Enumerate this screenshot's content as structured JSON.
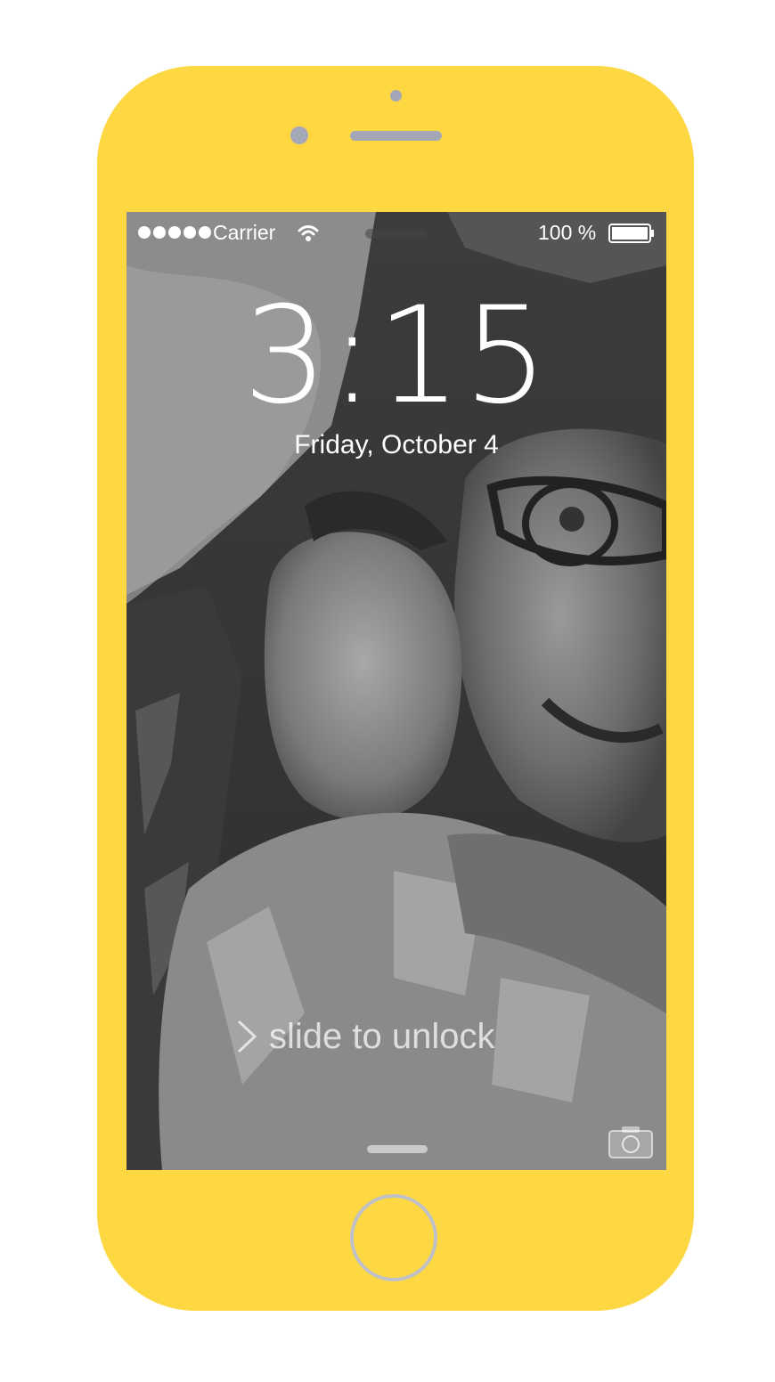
{
  "device": {
    "body_color": "#fdd843",
    "sensor_color": "#a4a7b6",
    "home_button_color": "#bfc0c8"
  },
  "status_bar": {
    "signal_dots": 5,
    "carrier": "Carrier",
    "wifi_icon": "wifi-icon",
    "battery_percent": "100 %",
    "battery_icon": "battery-full-icon"
  },
  "lock_screen": {
    "time": "3:15",
    "date": "Friday, October 4",
    "unlock_label": "slide to unlock",
    "unlock_icon": "chevron-right-icon",
    "camera_icon": "camera-icon",
    "wallpaper": "grayscale photo of adult and baby"
  }
}
